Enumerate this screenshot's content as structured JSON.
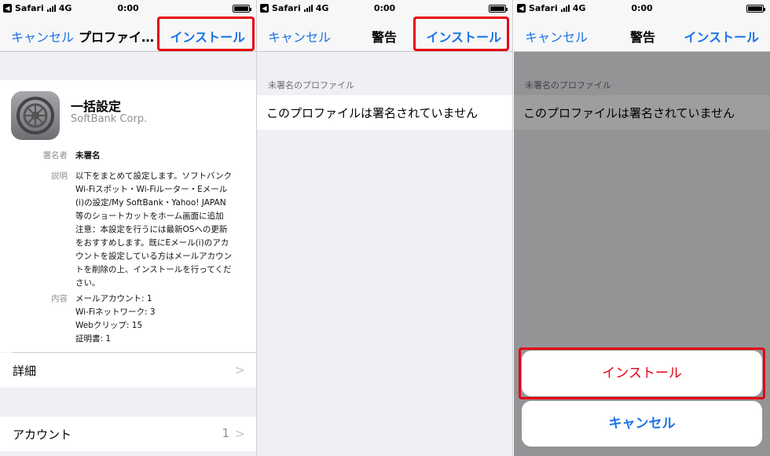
{
  "status": {
    "app": "Safari",
    "network": "4G",
    "time": "0:00"
  },
  "panel1": {
    "nav": {
      "cancel": "キャンセル",
      "title": "プロファイ…",
      "install": "インストール"
    },
    "profile": {
      "name": "一括設定",
      "org": "SoftBank Corp."
    },
    "details": {
      "signer_key": "署名者",
      "signer_value": "未署名",
      "desc_key": "説明",
      "desc_lines": [
        "以下をまとめて設定します。ソフトバンク",
        "Wi-Fiスポット・Wi-Fiルーター・Eメール",
        "(i)の設定/My SoftBank・Yahoo! JAPAN",
        "等のショートカットをホーム画面に追加",
        "注意：本設定を行うには最新OSへの更新",
        "をおすすめします。既にEメール(i)のアカ",
        "ウントを設定している方はメールアカウン",
        "トを削除の上、インストールを行ってくだ",
        "さい。"
      ],
      "content_key": "内容",
      "content_lines": [
        "メールアカウント: 1",
        "Wi-Fiネットワーク: 3",
        "Webクリップ: 15",
        "証明書: 1"
      ]
    },
    "more_label": "詳細",
    "account_label": "アカウント",
    "account_count": "1"
  },
  "panel2": {
    "nav": {
      "cancel": "キャンセル",
      "title": "警告",
      "install": "インストール"
    },
    "section_header": "未署名のプロファイル",
    "warning": "このプロファイルは署名されていません"
  },
  "panel3": {
    "nav": {
      "cancel": "キャンセル",
      "title": "警告",
      "install": "インストール"
    },
    "section_header": "未署名のプロファイル",
    "warning": "このプロファイルは署名されていません",
    "sheet_install": "インストール",
    "sheet_cancel": "キャンセル"
  },
  "colors": {
    "link": "#1a73e8",
    "highlight": "#e60012",
    "background": "#efeff4"
  }
}
